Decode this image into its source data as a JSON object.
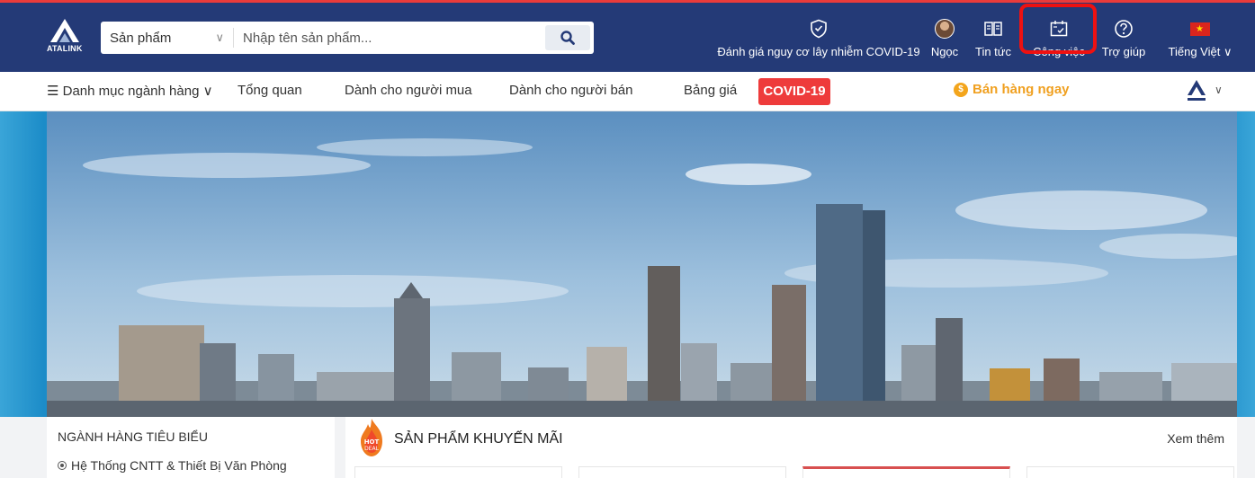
{
  "header": {
    "logo_text": "ATALINK",
    "search": {
      "category": "Sản phẩm",
      "placeholder": "Nhập tên sản phẩm..."
    },
    "nav": {
      "covid_assessment": "Đánh giá nguy cơ lây nhiễm COVID-19",
      "user": "Ngọc",
      "news": "Tin tức",
      "jobs": "Công việc",
      "help": "Trợ giúp",
      "language": "Tiếng Việt"
    },
    "colors": {
      "bar": "#243a77",
      "accent": "#ea3b3b"
    }
  },
  "subnav": {
    "categories": "Danh mục ngành hàng",
    "overview": "Tổng quan",
    "buyers": "Dành cho người mua",
    "sellers": "Dành cho người bán",
    "pricing": "Bảng giá",
    "covid": "COVID-19",
    "sell_now": "Bán hàng ngay"
  },
  "sidebar": {
    "title": "NGÀNH HÀNG TIÊU BIỂU",
    "items": [
      "Hệ Thống CNTT & Thiết Bị Văn Phòng"
    ]
  },
  "promo": {
    "badge": "HOT DEAL",
    "title": "SẢN PHẨM KHUYẾN MÃI",
    "more": "Xem thêm"
  },
  "icons": {
    "covid": "shield-check-icon",
    "news": "book-open-icon",
    "jobs": "calendar-icon",
    "help": "question-circle-icon",
    "search": "search-icon"
  }
}
